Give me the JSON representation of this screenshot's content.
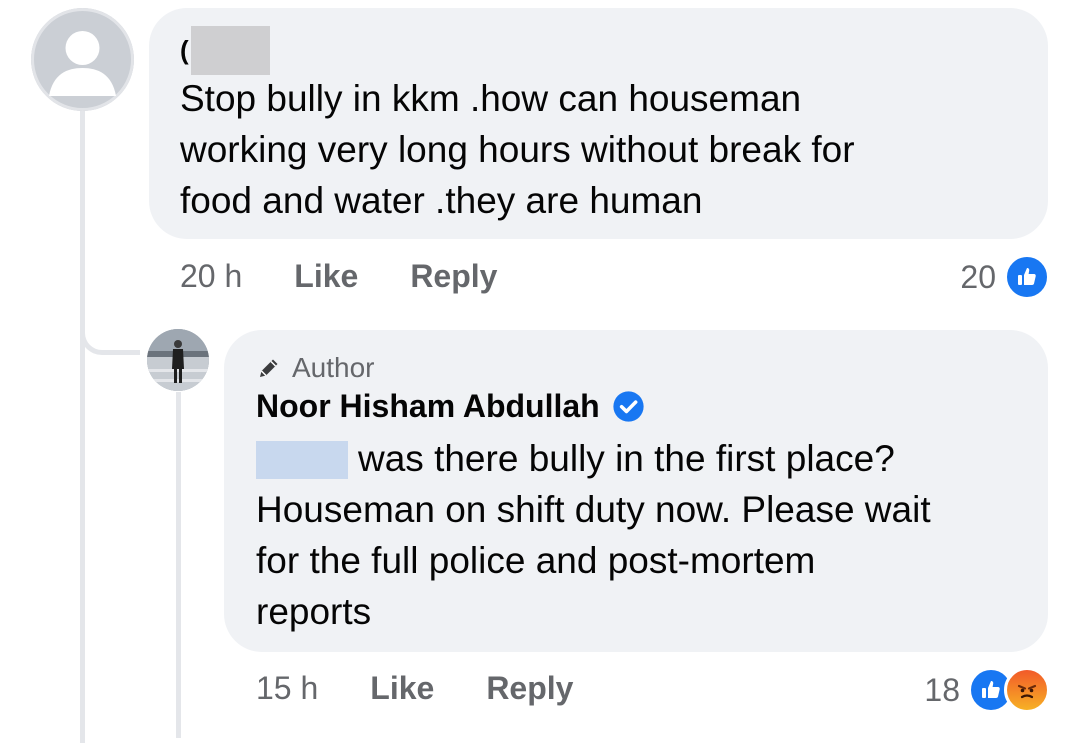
{
  "comment": {
    "name_initial": "(",
    "text": "Stop bully in kkm .how can houseman\nworking very long hours without break for\nfood and water .they are human",
    "time": "20 h",
    "like_label": "Like",
    "reply_label": "Reply",
    "reaction_count": "20",
    "reactions": [
      "like-icon"
    ]
  },
  "reply": {
    "badge": "Author",
    "badge_icon": "pencil-icon",
    "author_name": "Noor Hisham Abdullah",
    "verified_icon": "verified-badge-icon",
    "text": "was there bully in the first place?\nHouseman on shift duty now. Please wait\nfor the full police and post-mortem\nreports",
    "time": "15 h",
    "like_label": "Like",
    "reply_label": "Reply",
    "reaction_count": "18",
    "reactions": [
      "like-icon",
      "angry-icon"
    ]
  },
  "colors": {
    "bubble": "#f0f2f5",
    "meta_text": "#65676b",
    "like_blue": "#1877f2",
    "thread_line": "#e4e6ea"
  }
}
